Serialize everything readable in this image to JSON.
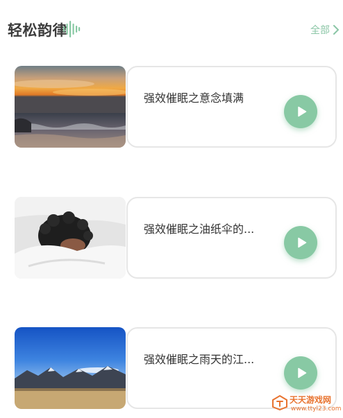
{
  "header": {
    "title": "轻松韵律",
    "wave_icon": "sound-wave-icon",
    "all_label": "全部",
    "accent_color": "#8bc6a6"
  },
  "tracks": [
    {
      "title": "强效催眠之意念填满",
      "image": "sunset-sea",
      "play_icon": "play-icon"
    },
    {
      "title": "强效催眠之油纸伞的...",
      "image": "sleeping-person",
      "play_icon": "play-icon"
    },
    {
      "title": "强效催眠之雨天的江...",
      "image": "mountain-sky",
      "play_icon": "play-icon"
    }
  ],
  "watermark": {
    "name": "天天游戏网",
    "url": "www.ttyl23.com"
  }
}
